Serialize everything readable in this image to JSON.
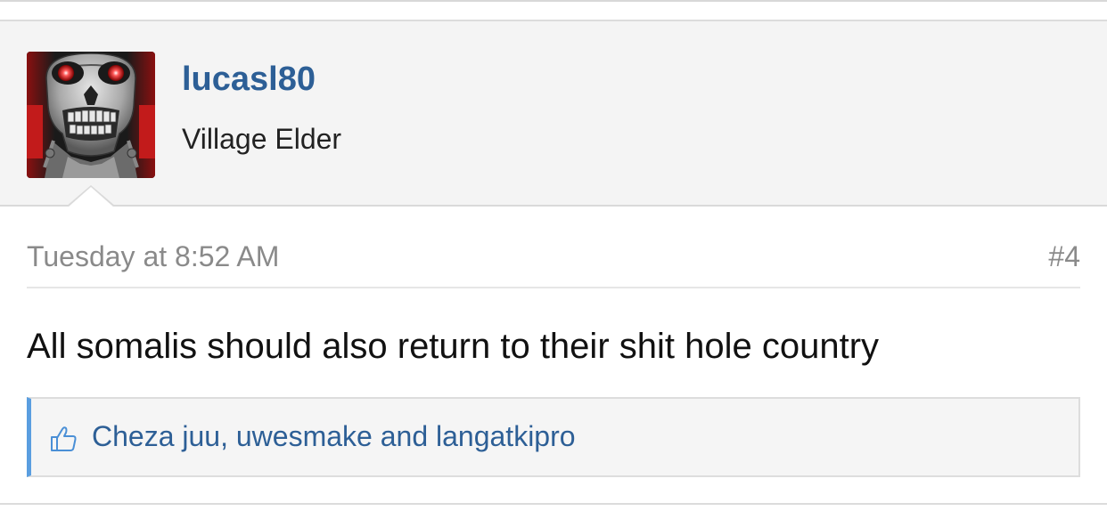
{
  "post": {
    "author": {
      "username": "lucasl80",
      "title": "Village Elder",
      "avatar_icon": "terminator-skull-avatar"
    },
    "timestamp": "Tuesday at 8:52 AM",
    "post_number": "#4",
    "message": "All somalis should also return to their shit hole country",
    "likes": {
      "icon": "thumbs-up-icon",
      "text": "Cheza juu, uwesmake and langatkipro"
    }
  },
  "colors": {
    "username": "#2d5f96",
    "link": "#2d5f96",
    "likes_accent": "#5a9ee0",
    "header_bg": "#f4f4f4",
    "muted_text": "#8a8a8a"
  }
}
